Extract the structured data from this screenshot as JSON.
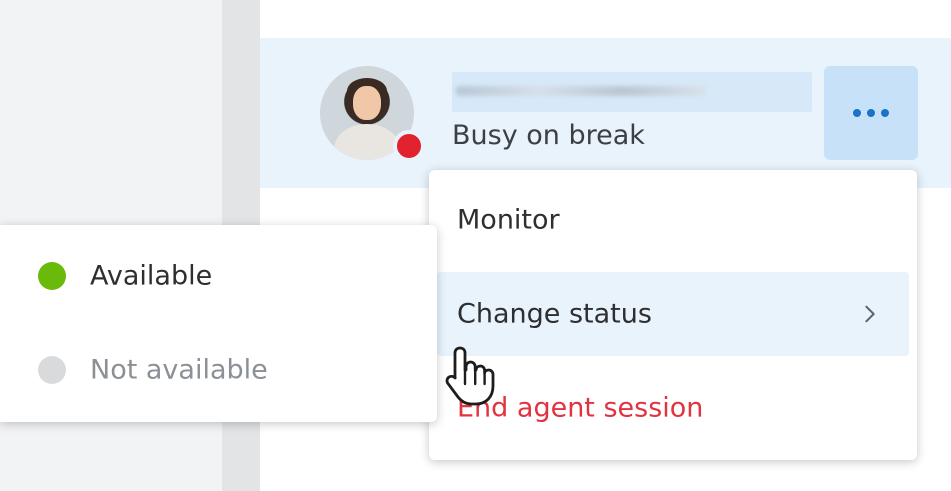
{
  "agent": {
    "status_text": "Busy on break",
    "status_color": "#e0232e"
  },
  "actions": {
    "more_icon": "more-horizontal-icon"
  },
  "context_menu": {
    "items": [
      {
        "label": "Monitor"
      },
      {
        "label": "Change status",
        "has_submenu": true
      },
      {
        "label": "End agent session",
        "color": "#e23341"
      }
    ]
  },
  "status_submenu": {
    "items": [
      {
        "label": "Available",
        "color": "#6aba0b"
      },
      {
        "label": "Not available",
        "color": "#d9dadc"
      }
    ]
  },
  "colors": {
    "accent": "#1a73c7",
    "row_highlight": "#e8f3fc"
  }
}
